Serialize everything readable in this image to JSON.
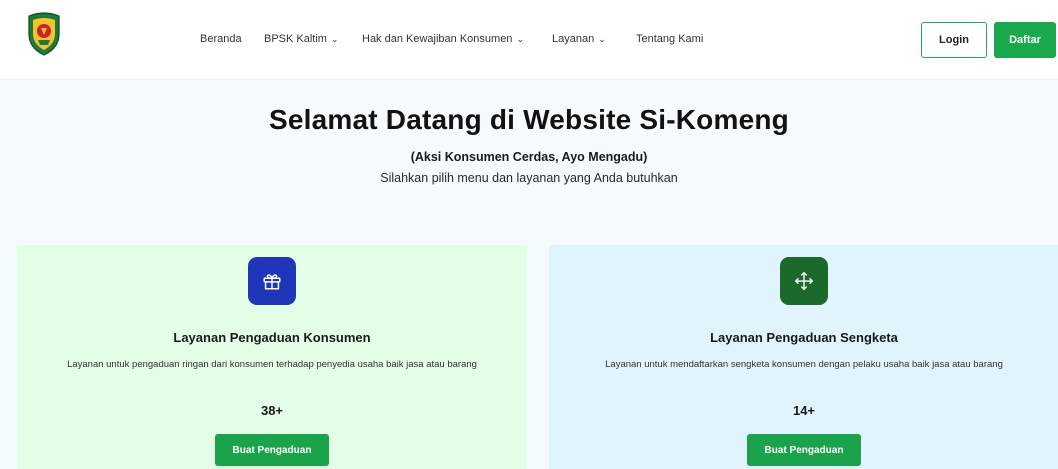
{
  "navbar": {
    "logo_icon": "regional-emblem-icon",
    "items": [
      {
        "label": "Beranda",
        "has_dropdown": false
      },
      {
        "label": "BPSK Kaltim",
        "has_dropdown": true
      },
      {
        "label": "Hak dan Kewajiban Konsumen",
        "has_dropdown": true
      },
      {
        "label": "Layanan",
        "has_dropdown": true
      },
      {
        "label": "Tentang Kami",
        "has_dropdown": false
      }
    ],
    "dropdown_icon": "chevron-down-icon",
    "login_label": "Login",
    "register_label": "Daftar"
  },
  "hero": {
    "title": "Selamat Datang di Website Si-Komeng",
    "subtitle": "(Aksi Konsumen Cerdas, Ayo Mengadu)",
    "description": "Silahkan pilih menu dan layanan yang Anda butuhkan"
  },
  "cards": [
    {
      "icon": "gift-icon",
      "title": "Layanan Pengaduan Konsumen",
      "description": "Layanan untuk pengaduan ringan dari konsumen terhadap penyedia usaha baik jasa atau barang",
      "count": "38+",
      "button_label": "Buat Pengaduan"
    },
    {
      "icon": "move-arrows-icon",
      "title": "Layanan Pengaduan Sengketa",
      "description": "Layanan untuk mendaftarkan sengketa konsumen dengan pelaku usaha baik jasa atau barang",
      "count": "14+",
      "button_label": "Buat Pengaduan"
    }
  ],
  "colors": {
    "brand_green": "#19a84b",
    "card_blue_icon": "#1f36b8",
    "card_green_icon": "#1b6a2c",
    "card_green_bg": "#e3fde6",
    "card_blue_bg": "#e1f3fd"
  }
}
